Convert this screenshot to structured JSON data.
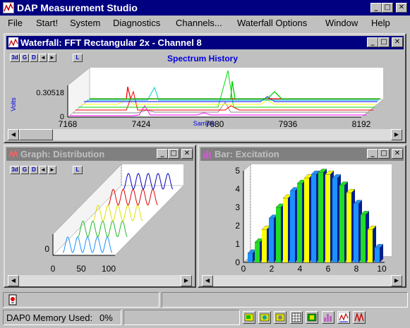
{
  "app": {
    "title": "DAP Measurement Studio",
    "window_buttons": {
      "minimize": "_",
      "maximize": "□",
      "close": "✕"
    }
  },
  "menu": [
    "File",
    "Start!",
    "System",
    "Diagnostics",
    "Channels...",
    "Waterfall Options",
    "Window",
    "Help"
  ],
  "toolbar_buttons": [
    "3d",
    "G",
    "D",
    "◄",
    "►",
    "L"
  ],
  "waterfall": {
    "title": "Waterfall: FFT Rectangular 2x - Channel 8",
    "chart_title": "Spectrum History",
    "ylabel": "Volts",
    "xlabel": "Sample",
    "y_tick": "0.30518",
    "y_zero": "0",
    "x_ticks": [
      "7168",
      "7424",
      "7680",
      "7936",
      "8192"
    ]
  },
  "graph": {
    "title": "Graph: Distribution",
    "y_zero": "0",
    "x_ticks": [
      "0",
      "50",
      "100"
    ]
  },
  "bar": {
    "title": "Bar: Excitation",
    "y_ticks": [
      "0",
      "1",
      "2",
      "3",
      "4",
      "5"
    ],
    "x_ticks": [
      "0",
      "2",
      "4",
      "6",
      "8",
      "10"
    ]
  },
  "status": {
    "memory_label": "DAP0 Memory Used:",
    "memory_value": "0%"
  },
  "colors": {
    "title_active": "#000080",
    "title_inactive": "#808080",
    "face": "#c0c0c0",
    "chart_blue": "#0000ff",
    "bar_blue": "#1e90ff",
    "bar_green": "#22dd22",
    "bar_yellow": "#ffff00",
    "bar_navy": "#00208a"
  },
  "chart_data": [
    {
      "type": "bar",
      "title": "",
      "xlabel": "",
      "ylabel": "",
      "xlim": [
        0,
        10
      ],
      "ylim": [
        0,
        5
      ],
      "categories": [
        0.5,
        1,
        1.5,
        2,
        2.5,
        3,
        3.5,
        4,
        4.5,
        5,
        5.5,
        6,
        6.5,
        7,
        7.5,
        8,
        8.5,
        9,
        9.5
      ],
      "values": [
        0.5,
        1.1,
        1.8,
        2.4,
        3.0,
        3.5,
        3.9,
        4.3,
        4.6,
        4.8,
        4.9,
        4.8,
        4.6,
        4.2,
        3.8,
        3.2,
        2.6,
        1.8,
        0.8
      ]
    },
    {
      "type": "line",
      "title": "",
      "xlim": [
        0,
        100
      ],
      "series": [
        {
          "color": "#1e90ff",
          "values": [
            0,
            1,
            0,
            1,
            0,
            1,
            0,
            1,
            0,
            1
          ]
        },
        {
          "color": "#22bb22",
          "values": [
            0,
            1,
            0,
            1,
            0,
            1,
            0,
            1,
            0,
            1
          ]
        },
        {
          "color": "#e0e000",
          "values": [
            0,
            1,
            0,
            1,
            0,
            1,
            0,
            1,
            0,
            1
          ]
        },
        {
          "color": "#e00000",
          "values": [
            0,
            1,
            0,
            1,
            0,
            1,
            0,
            1,
            0,
            1
          ]
        },
        {
          "color": "#0000c0",
          "values": [
            0,
            1,
            0,
            1,
            0,
            1,
            0,
            1,
            0,
            1
          ]
        }
      ]
    },
    {
      "type": "line",
      "title": "Spectrum History",
      "xlabel": "Sample",
      "ylabel": "Volts",
      "xlim": [
        7168,
        8192
      ],
      "peaks": [
        7350,
        7710,
        7850
      ]
    }
  ]
}
